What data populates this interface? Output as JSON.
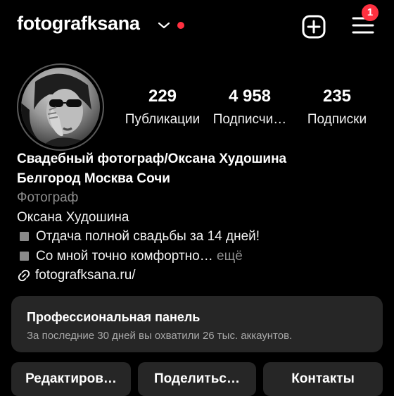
{
  "colors": {
    "accent_red": "#ff3040",
    "panel_bg": "#262626",
    "muted": "#8e8e8e"
  },
  "header": {
    "username": "fotografksana",
    "dropdown_icon": "chevron-down-icon",
    "new_post_icon": "plus-square-icon",
    "menu_icon": "hamburger-menu-icon",
    "notification_count": "1"
  },
  "profile": {
    "avatar_icon": "profile-photo",
    "stats": [
      {
        "value": "229",
        "label": "Публикации"
      },
      {
        "value": "4 958",
        "label": "Подписчи…"
      },
      {
        "value": "235",
        "label": "Подписки"
      }
    ]
  },
  "bio": {
    "name_line1": "Свадебный фотограф/Оксана Худошина",
    "name_line2": "Белгород Москва Сочи",
    "category": "Фотограф",
    "line1": "Оксана Худошина",
    "line2": "Отдача полной свадьбы за 14 дней!",
    "line3": "Со мной точно комфортно…",
    "more": "ещё",
    "link": "fotografksana.ru/"
  },
  "pro_panel": {
    "title": "Профессиональная панель",
    "subtitle": "За последние 30 дней вы охватили 26 тыс. аккаунтов."
  },
  "buttons": {
    "edit": "Редактиров…",
    "share": "Поделитьс…",
    "contacts": "Контакты"
  }
}
